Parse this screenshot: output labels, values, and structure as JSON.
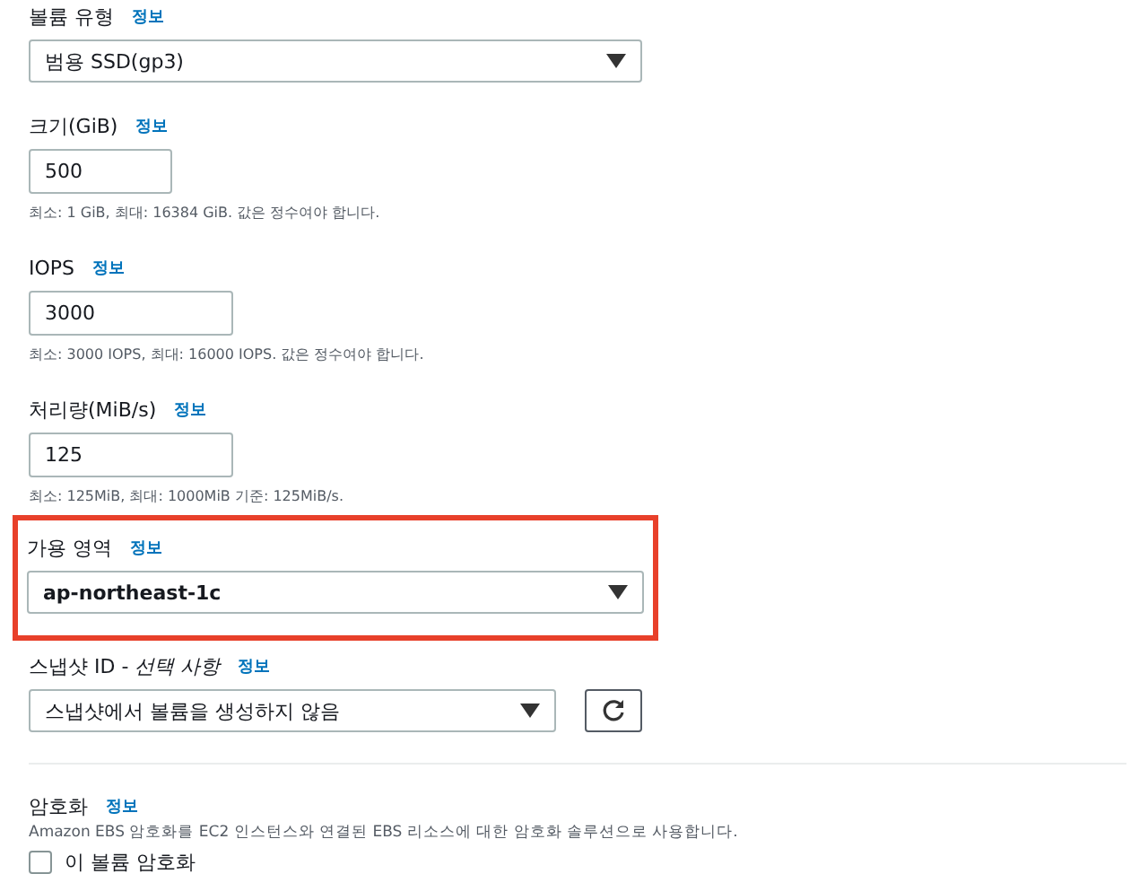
{
  "fields": [
    {
      "kind": "select",
      "label": "볼륨 유형",
      "info": "정보",
      "value": "범용 SSD(gp3)",
      "highlighted": false
    },
    {
      "kind": "input",
      "label": "크기(GiB)",
      "info": "정보",
      "value": "500",
      "hint": "최소: 1 GiB, 최대: 16384 GiB. 값은 정수여야 합니다.",
      "highlighted": false
    },
    {
      "kind": "input",
      "label": "IOPS",
      "info": "정보",
      "value": "3000",
      "hint": "최소: 3000 IOPS, 최대: 16000 IOPS. 값은 정수여야 합니다.",
      "highlighted": false
    },
    {
      "kind": "input",
      "label": "처리량(MiB/s)",
      "info": "정보",
      "value": "125",
      "hint": "최소: 125MiB, 최대: 1000MiB 기준: 125MiB/s.",
      "highlighted": false
    },
    {
      "kind": "select",
      "label": "가용 영역",
      "info": "정보",
      "value": "ap-northeast-1c",
      "highlighted": true
    },
    {
      "kind": "select-refresh",
      "label": "스냅샷 ID - *선택 사항*",
      "info": "정보",
      "value": "스냅샷에서 볼륨을 생성하지 않음",
      "highlighted": false
    }
  ],
  "encryption": {
    "label": "암호화",
    "info": "정보",
    "description": "Amazon EBS 암호화를 EC2 인스턴스와 연결된 EBS 리소스에 대한 암호화 솔루션으로 사용합니다.",
    "checkbox": {
      "label": "이 볼륨 암호화",
      "checked": false
    }
  }
}
